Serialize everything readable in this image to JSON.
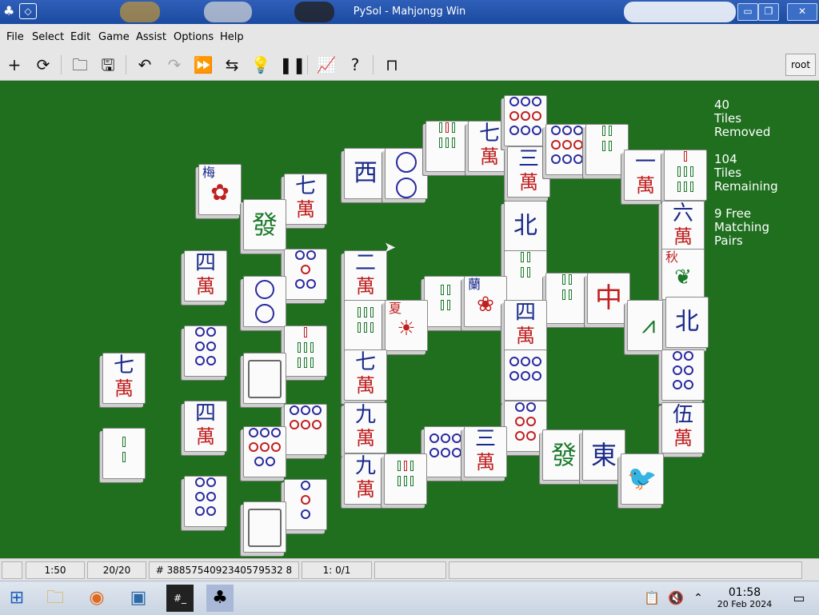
{
  "window": {
    "title": "PySol - Mahjongg Win"
  },
  "menu": [
    "File",
    "Select",
    "Edit",
    "Game",
    "Assist",
    "Options",
    "Help"
  ],
  "toolbar": {
    "user_label": "root",
    "buttons": [
      "new-game",
      "restart",
      "open",
      "save",
      "undo",
      "redo",
      "autodrop",
      "shuffle",
      "hint",
      "pause",
      "statistics",
      "rules",
      "quit"
    ]
  },
  "stats": {
    "removed_count": "40",
    "removed_label1": "Tiles",
    "removed_label2": "Removed",
    "remaining_count": "104",
    "remaining_label1": "Tiles",
    "remaining_label2": "Remaining",
    "free_line1": "9 Free",
    "free_line2": "Matching",
    "free_line3": "Pairs"
  },
  "tiles": {
    "plum": "梅",
    "seven_wan": "七",
    "wan": "萬",
    "fa": "發",
    "four": "四",
    "two": "二",
    "three": "三",
    "nine": "九",
    "six": "六",
    "one": "一",
    "five": "伍",
    "west": "西",
    "north": "北",
    "east": "東",
    "zhong": "中",
    "lan": "蘭",
    "xia": "夏",
    "qiu": "秋"
  },
  "statusbar": {
    "time": "1:50",
    "moves": "20/20",
    "game_number": "# 3885754092340579532 8",
    "score": "1: 0/1"
  },
  "taskbar": {
    "clock_time": "01:58",
    "clock_date": "20 Feb 2024"
  }
}
